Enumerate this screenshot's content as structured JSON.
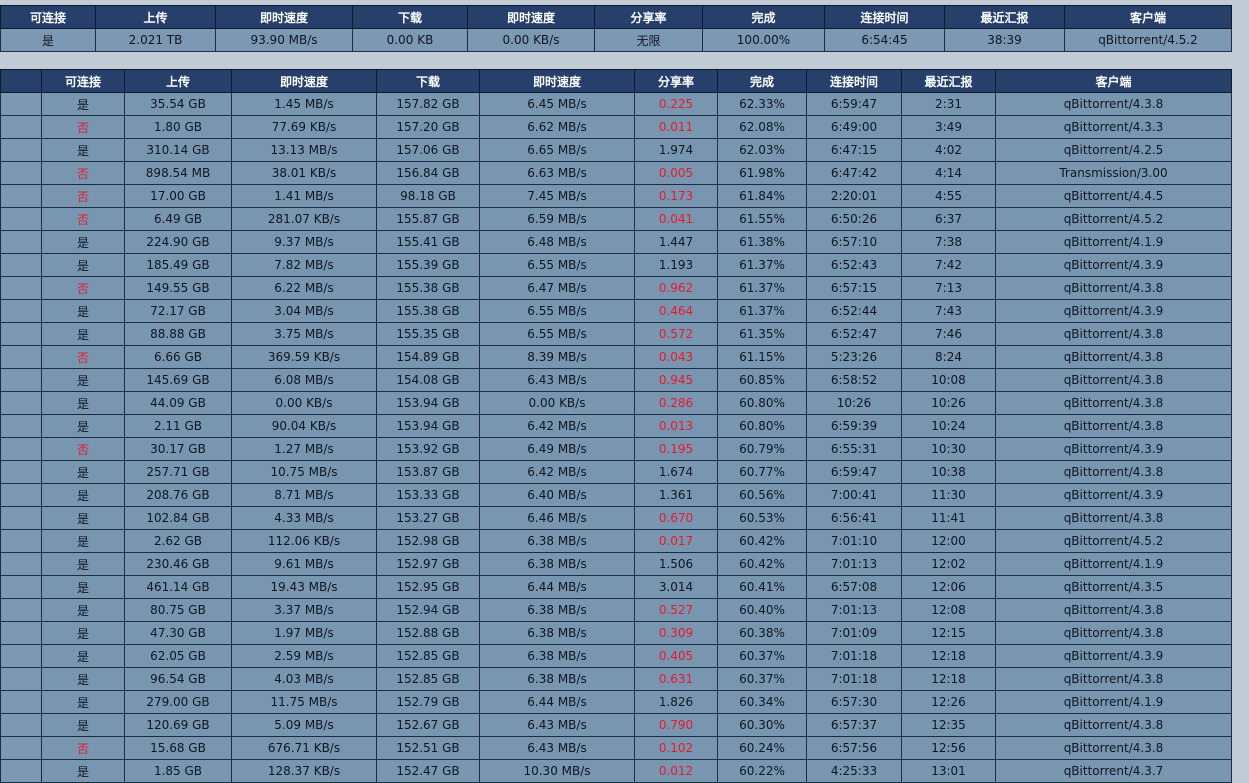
{
  "headers": [
    "可连接",
    "上传",
    "即时速度",
    "下载",
    "即时速度",
    "分享率",
    "完成",
    "连接时间",
    "最近汇报",
    "客户端"
  ],
  "summary": {
    "connectable": "是",
    "upload": "2.021 TB",
    "up_speed": "93.90 MB/s",
    "download": "0.00 KB",
    "down_speed": "0.00 KB/s",
    "ratio": "无限",
    "completed": "100.00%",
    "connect_time": "6:54:45",
    "last_report": "38:39",
    "client": "qBittorrent/4.5.2"
  },
  "colors": {
    "header_bg": "#26406b",
    "row_bg": "#7996b0",
    "low_ratio": "#e8192c",
    "not_connectable": "#e8192c"
  },
  "peers": [
    {
      "c": "是",
      "up": "35.54 GB",
      "ups": "1.45 MB/s",
      "dl": "157.82 GB",
      "dls": "6.45 MB/s",
      "r": "0.225",
      "rr": true,
      "comp": "62.33%",
      "t": "6:59:47",
      "lr": "2:31",
      "cl": "qBittorrent/4.3.8"
    },
    {
      "c": "否",
      "up": "1.80 GB",
      "ups": "77.69 KB/s",
      "dl": "157.20 GB",
      "dls": "6.62 MB/s",
      "r": "0.011",
      "rr": true,
      "comp": "62.08%",
      "t": "6:49:00",
      "lr": "3:49",
      "cl": "qBittorrent/4.3.3"
    },
    {
      "c": "是",
      "up": "310.14 GB",
      "ups": "13.13 MB/s",
      "dl": "157.06 GB",
      "dls": "6.65 MB/s",
      "r": "1.974",
      "rr": false,
      "comp": "62.03%",
      "t": "6:47:15",
      "lr": "4:02",
      "cl": "qBittorrent/4.2.5"
    },
    {
      "c": "否",
      "up": "898.54 MB",
      "ups": "38.01 KB/s",
      "dl": "156.84 GB",
      "dls": "6.63 MB/s",
      "r": "0.005",
      "rr": true,
      "comp": "61.98%",
      "t": "6:47:42",
      "lr": "4:14",
      "cl": "Transmission/3.00"
    },
    {
      "c": "否",
      "up": "17.00 GB",
      "ups": "1.41 MB/s",
      "dl": "98.18 GB",
      "dls": "7.45 MB/s",
      "r": "0.173",
      "rr": true,
      "comp": "61.84%",
      "t": "2:20:01",
      "lr": "4:55",
      "cl": "qBittorrent/4.4.5"
    },
    {
      "c": "否",
      "up": "6.49 GB",
      "ups": "281.07 KB/s",
      "dl": "155.87 GB",
      "dls": "6.59 MB/s",
      "r": "0.041",
      "rr": true,
      "comp": "61.55%",
      "t": "6:50:26",
      "lr": "6:37",
      "cl": "qBittorrent/4.5.2"
    },
    {
      "c": "是",
      "up": "224.90 GB",
      "ups": "9.37 MB/s",
      "dl": "155.41 GB",
      "dls": "6.48 MB/s",
      "r": "1.447",
      "rr": false,
      "comp": "61.38%",
      "t": "6:57:10",
      "lr": "7:38",
      "cl": "qBittorrent/4.1.9"
    },
    {
      "c": "是",
      "up": "185.49 GB",
      "ups": "7.82 MB/s",
      "dl": "155.39 GB",
      "dls": "6.55 MB/s",
      "r": "1.193",
      "rr": false,
      "comp": "61.37%",
      "t": "6:52:43",
      "lr": "7:42",
      "cl": "qBittorrent/4.3.9"
    },
    {
      "c": "否",
      "up": "149.55 GB",
      "ups": "6.22 MB/s",
      "dl": "155.38 GB",
      "dls": "6.47 MB/s",
      "r": "0.962",
      "rr": true,
      "comp": "61.37%",
      "t": "6:57:15",
      "lr": "7:13",
      "cl": "qBittorrent/4.3.8"
    },
    {
      "c": "是",
      "up": "72.17 GB",
      "ups": "3.04 MB/s",
      "dl": "155.38 GB",
      "dls": "6.55 MB/s",
      "r": "0.464",
      "rr": true,
      "comp": "61.37%",
      "t": "6:52:44",
      "lr": "7:43",
      "cl": "qBittorrent/4.3.9"
    },
    {
      "c": "是",
      "up": "88.88 GB",
      "ups": "3.75 MB/s",
      "dl": "155.35 GB",
      "dls": "6.55 MB/s",
      "r": "0.572",
      "rr": true,
      "comp": "61.35%",
      "t": "6:52:47",
      "lr": "7:46",
      "cl": "qBittorrent/4.3.8"
    },
    {
      "c": "否",
      "up": "6.66 GB",
      "ups": "369.59 KB/s",
      "dl": "154.89 GB",
      "dls": "8.39 MB/s",
      "r": "0.043",
      "rr": true,
      "comp": "61.15%",
      "t": "5:23:26",
      "lr": "8:24",
      "cl": "qBittorrent/4.3.8"
    },
    {
      "c": "是",
      "up": "145.69 GB",
      "ups": "6.08 MB/s",
      "dl": "154.08 GB",
      "dls": "6.43 MB/s",
      "r": "0.945",
      "rr": true,
      "comp": "60.85%",
      "t": "6:58:52",
      "lr": "10:08",
      "cl": "qBittorrent/4.3.8"
    },
    {
      "c": "是",
      "up": "44.09 GB",
      "ups": "0.00 KB/s",
      "dl": "153.94 GB",
      "dls": "0.00 KB/s",
      "r": "0.286",
      "rr": true,
      "comp": "60.80%",
      "t": "10:26",
      "lr": "10:26",
      "cl": "qBittorrent/4.3.8"
    },
    {
      "c": "是",
      "up": "2.11 GB",
      "ups": "90.04 KB/s",
      "dl": "153.94 GB",
      "dls": "6.42 MB/s",
      "r": "0.013",
      "rr": true,
      "comp": "60.80%",
      "t": "6:59:39",
      "lr": "10:24",
      "cl": "qBittorrent/4.3.8"
    },
    {
      "c": "否",
      "up": "30.17 GB",
      "ups": "1.27 MB/s",
      "dl": "153.92 GB",
      "dls": "6.49 MB/s",
      "r": "0.195",
      "rr": true,
      "comp": "60.79%",
      "t": "6:55:31",
      "lr": "10:30",
      "cl": "qBittorrent/4.3.9"
    },
    {
      "c": "是",
      "up": "257.71 GB",
      "ups": "10.75 MB/s",
      "dl": "153.87 GB",
      "dls": "6.42 MB/s",
      "r": "1.674",
      "rr": false,
      "comp": "60.77%",
      "t": "6:59:47",
      "lr": "10:38",
      "cl": "qBittorrent/4.3.8"
    },
    {
      "c": "是",
      "up": "208.76 GB",
      "ups": "8.71 MB/s",
      "dl": "153.33 GB",
      "dls": "6.40 MB/s",
      "r": "1.361",
      "rr": false,
      "comp": "60.56%",
      "t": "7:00:41",
      "lr": "11:30",
      "cl": "qBittorrent/4.3.9"
    },
    {
      "c": "是",
      "up": "102.84 GB",
      "ups": "4.33 MB/s",
      "dl": "153.27 GB",
      "dls": "6.46 MB/s",
      "r": "0.670",
      "rr": true,
      "comp": "60.53%",
      "t": "6:56:41",
      "lr": "11:41",
      "cl": "qBittorrent/4.3.8"
    },
    {
      "c": "是",
      "up": "2.62 GB",
      "ups": "112.06 KB/s",
      "dl": "152.98 GB",
      "dls": "6.38 MB/s",
      "r": "0.017",
      "rr": true,
      "comp": "60.42%",
      "t": "7:01:10",
      "lr": "12:00",
      "cl": "qBittorrent/4.5.2"
    },
    {
      "c": "是",
      "up": "230.46 GB",
      "ups": "9.61 MB/s",
      "dl": "152.97 GB",
      "dls": "6.38 MB/s",
      "r": "1.506",
      "rr": false,
      "comp": "60.42%",
      "t": "7:01:13",
      "lr": "12:02",
      "cl": "qBittorrent/4.1.9"
    },
    {
      "c": "是",
      "up": "461.14 GB",
      "ups": "19.43 MB/s",
      "dl": "152.95 GB",
      "dls": "6.44 MB/s",
      "r": "3.014",
      "rr": false,
      "comp": "60.41%",
      "t": "6:57:08",
      "lr": "12:06",
      "cl": "qBittorrent/4.3.5"
    },
    {
      "c": "是",
      "up": "80.75 GB",
      "ups": "3.37 MB/s",
      "dl": "152.94 GB",
      "dls": "6.38 MB/s",
      "r": "0.527",
      "rr": true,
      "comp": "60.40%",
      "t": "7:01:13",
      "lr": "12:08",
      "cl": "qBittorrent/4.3.8"
    },
    {
      "c": "是",
      "up": "47.30 GB",
      "ups": "1.97 MB/s",
      "dl": "152.88 GB",
      "dls": "6.38 MB/s",
      "r": "0.309",
      "rr": true,
      "comp": "60.38%",
      "t": "7:01:09",
      "lr": "12:15",
      "cl": "qBittorrent/4.3.8"
    },
    {
      "c": "是",
      "up": "62.05 GB",
      "ups": "2.59 MB/s",
      "dl": "152.85 GB",
      "dls": "6.38 MB/s",
      "r": "0.405",
      "rr": true,
      "comp": "60.37%",
      "t": "7:01:18",
      "lr": "12:18",
      "cl": "qBittorrent/4.3.9"
    },
    {
      "c": "是",
      "up": "96.54 GB",
      "ups": "4.03 MB/s",
      "dl": "152.85 GB",
      "dls": "6.38 MB/s",
      "r": "0.631",
      "rr": true,
      "comp": "60.37%",
      "t": "7:01:18",
      "lr": "12:18",
      "cl": "qBittorrent/4.3.8"
    },
    {
      "c": "是",
      "up": "279.00 GB",
      "ups": "11.75 MB/s",
      "dl": "152.79 GB",
      "dls": "6.44 MB/s",
      "r": "1.826",
      "rr": false,
      "comp": "60.34%",
      "t": "6:57:30",
      "lr": "12:26",
      "cl": "qBittorrent/4.1.9"
    },
    {
      "c": "是",
      "up": "120.69 GB",
      "ups": "5.09 MB/s",
      "dl": "152.67 GB",
      "dls": "6.43 MB/s",
      "r": "0.790",
      "rr": true,
      "comp": "60.30%",
      "t": "6:57:37",
      "lr": "12:35",
      "cl": "qBittorrent/4.3.8"
    },
    {
      "c": "否",
      "up": "15.68 GB",
      "ups": "676.71 KB/s",
      "dl": "152.51 GB",
      "dls": "6.43 MB/s",
      "r": "0.102",
      "rr": true,
      "comp": "60.24%",
      "t": "6:57:56",
      "lr": "12:56",
      "cl": "qBittorrent/4.3.8"
    },
    {
      "c": "是",
      "up": "1.85 GB",
      "ups": "128.37 KB/s",
      "dl": "152.47 GB",
      "dls": "10.30 MB/s",
      "r": "0.012",
      "rr": true,
      "comp": "60.22%",
      "t": "4:25:33",
      "lr": "13:01",
      "cl": "qBittorrent/4.3.7"
    }
  ]
}
